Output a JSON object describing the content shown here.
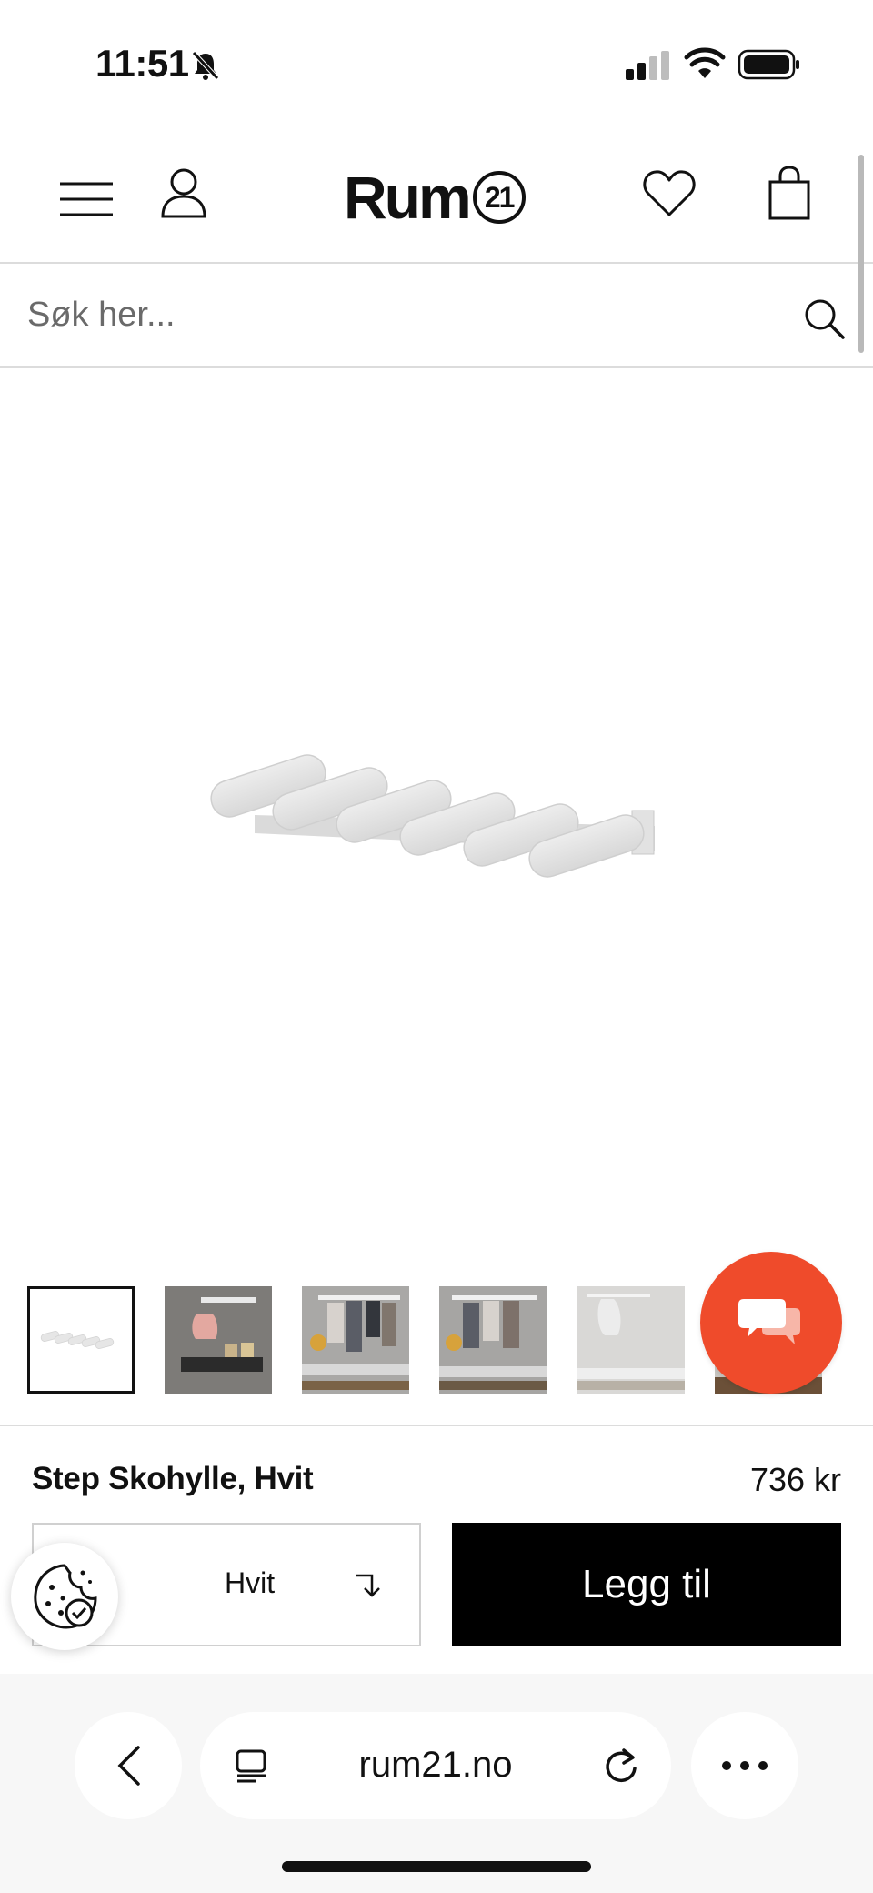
{
  "status_bar": {
    "time": "11:51"
  },
  "header": {
    "logo_text": "Rum",
    "logo_number": "21",
    "icons": [
      "menu-icon",
      "user-icon",
      "heart-icon",
      "bag-icon"
    ]
  },
  "search": {
    "placeholder": "Søk her..."
  },
  "product": {
    "name": "Step Skohylle, Hvit",
    "price": "736 kr",
    "variant": "Hvit",
    "add_label": "Legg til"
  },
  "browser": {
    "url": "rum21.no"
  },
  "colors": {
    "chat_accent": "#ef4b2b",
    "button_bg": "#000000"
  }
}
